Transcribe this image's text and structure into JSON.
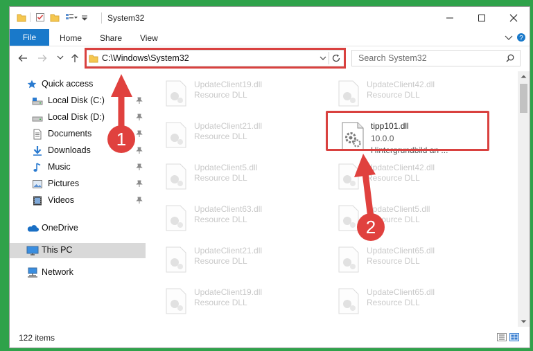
{
  "window": {
    "title": "System32"
  },
  "ribbon": {
    "tabs": [
      "File",
      "Home",
      "Share",
      "View"
    ]
  },
  "address": {
    "path": "C:\\Windows\\System32",
    "search_placeholder": "Search System32"
  },
  "nav": {
    "items": [
      {
        "label": "Quick access",
        "icon": "star-icon",
        "pinned": false
      },
      {
        "label": "Local Disk (C:)",
        "icon": "drive-icon",
        "pinned": true
      },
      {
        "label": "Local Disk (D:)",
        "icon": "drive-icon",
        "pinned": true
      },
      {
        "label": "Documents",
        "icon": "documents-icon",
        "pinned": true
      },
      {
        "label": "Downloads",
        "icon": "downloads-icon",
        "pinned": true
      },
      {
        "label": "Music",
        "icon": "music-icon",
        "pinned": true
      },
      {
        "label": "Pictures",
        "icon": "pictures-icon",
        "pinned": true
      },
      {
        "label": "Videos",
        "icon": "videos-icon",
        "pinned": true
      },
      {
        "label": "OneDrive",
        "icon": "onedrive-icon",
        "pinned": false
      },
      {
        "label": "This PC",
        "icon": "this-pc-icon",
        "pinned": false
      },
      {
        "label": "Network",
        "icon": "network-icon",
        "pinned": false
      }
    ]
  },
  "files": {
    "left": [
      {
        "name": "UpdateClient19.dll",
        "type": "Resource DLL"
      },
      {
        "name": "UpdateClient21.dll",
        "type": "Resource DLL"
      },
      {
        "name": "UpdateClient5.dll",
        "type": "Resource DLL"
      },
      {
        "name": "UpdateClient63.dll",
        "type": "Resource DLL"
      },
      {
        "name": "UpdateClient21.dll",
        "type": "Resource DLL"
      },
      {
        "name": "UpdateClient19.dll",
        "type": "Resource DLL"
      }
    ],
    "right": [
      {
        "name": "UpdateClient42.dll",
        "type": "Resource DLL"
      },
      {
        "name": "UpdateClient42.dll",
        "type": "Resource DLL"
      },
      {
        "name": "UpdateClient5.dll",
        "type": "Resource DLL"
      },
      {
        "name": "UpdateClient65.dll",
        "type": "Resource DLL"
      },
      {
        "name": "UpdateClient65.dll",
        "type": "Resource DLL"
      }
    ],
    "highlighted": {
      "name": "tipp101.dll",
      "version": "10.0.0",
      "description": "Hintergrundbild an ..."
    }
  },
  "status": {
    "items_count": "122 items"
  },
  "annotations": {
    "step1": "1",
    "step2": "2",
    "color": "#e0413e"
  }
}
